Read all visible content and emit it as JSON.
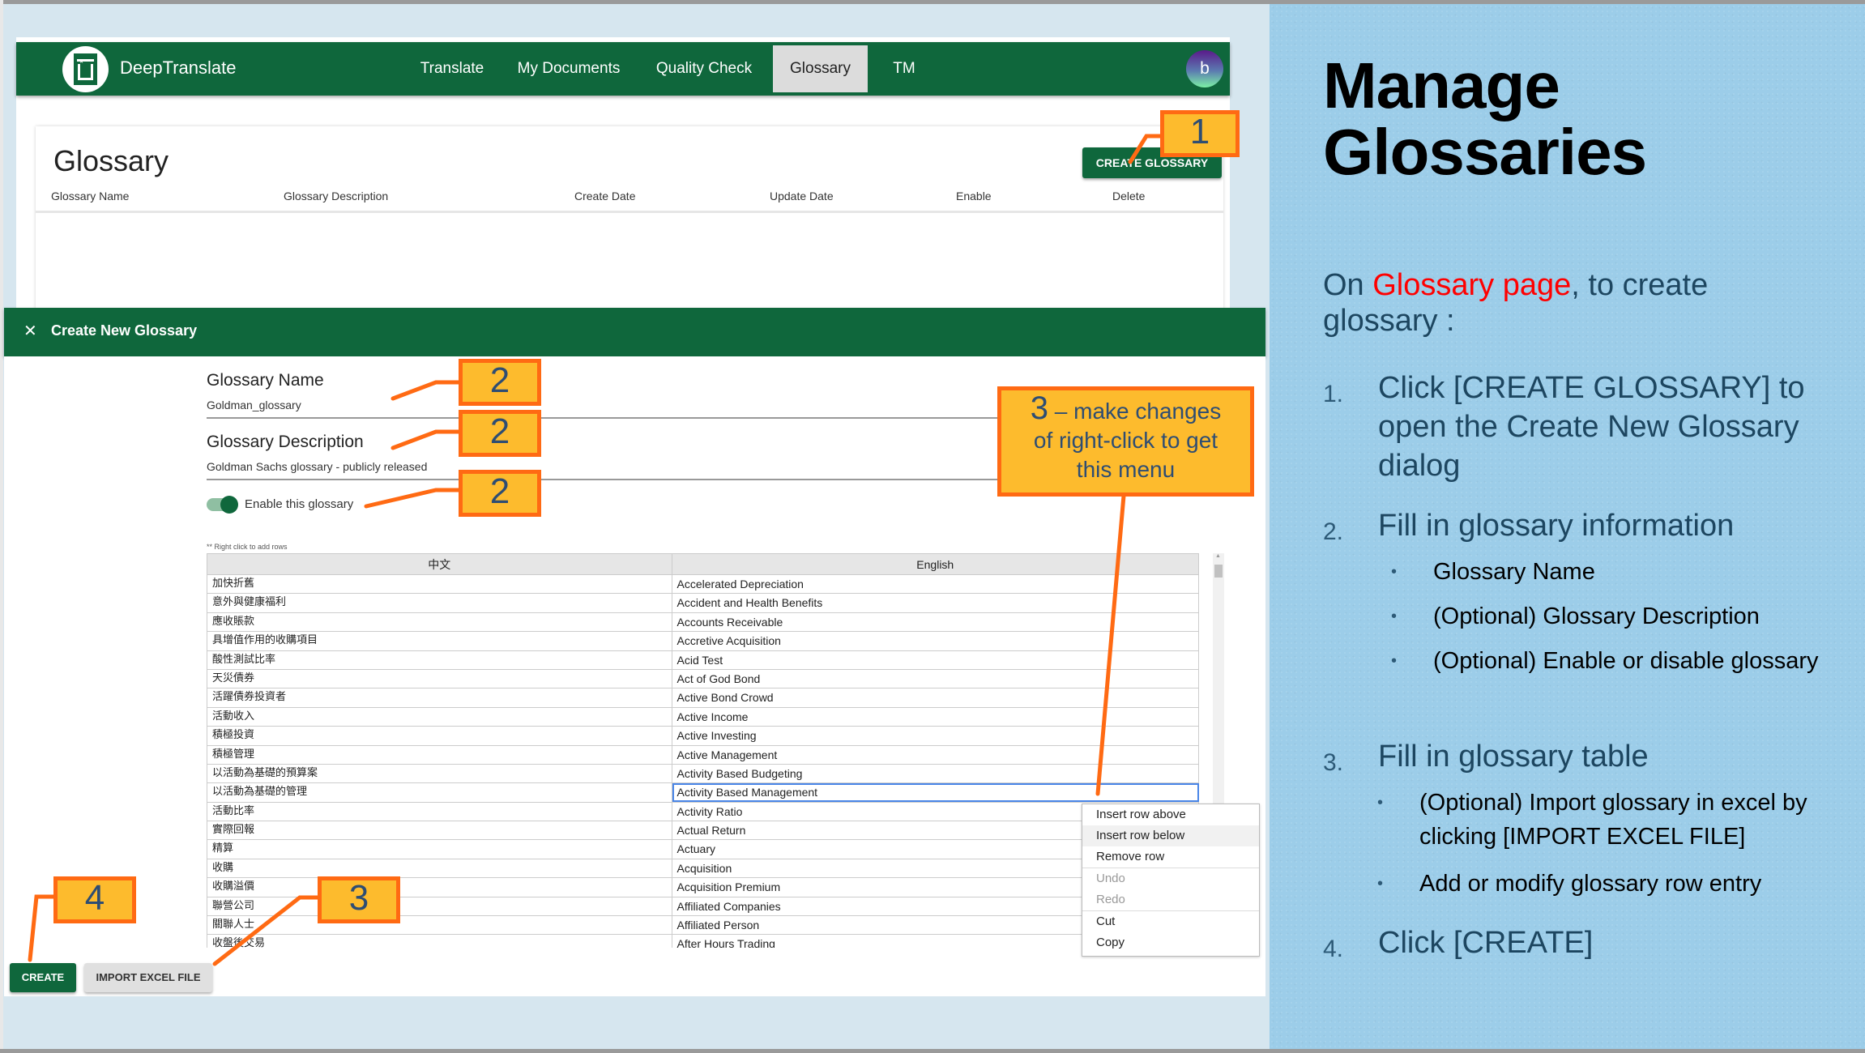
{
  "app": {
    "brand": "DeepTranslate",
    "logo_icon": "deeptranslate-logo-icon",
    "nav": [
      {
        "label": "Translate",
        "active": false
      },
      {
        "label": "My Documents",
        "active": false
      },
      {
        "label": "Quality Check",
        "active": false
      },
      {
        "label": "Glossary",
        "active": true
      },
      {
        "label": "TM",
        "active": false
      }
    ],
    "avatar_initial": "b",
    "accent_color": "#0f673c"
  },
  "glossary_page": {
    "title": "Glossary",
    "create_button": "CREATE GLOSSARY",
    "columns": [
      "Glossary Name",
      "Glossary Description",
      "Create Date",
      "Update Date",
      "Enable",
      "Delete"
    ]
  },
  "dialog": {
    "close_icon": "close-icon",
    "title": "Create New Glossary",
    "name_label": "Glossary Name",
    "name_value": "Goldman_glossary",
    "description_label": "Glossary Description",
    "description_value": "Goldman Sachs glossary - publicly released",
    "enable_label": "Enable this glossary",
    "enable_on": true,
    "hint": "** Right click to add rows",
    "table": {
      "headers": [
        "中文",
        "English"
      ],
      "rows": [
        [
          "加快折舊",
          "Accelerated Depreciation"
        ],
        [
          "意外與健康福利",
          "Accident and Health Benefits"
        ],
        [
          "應收賬款",
          "Accounts Receivable"
        ],
        [
          "具增值作用的收購項目",
          "Accretive Acquisition"
        ],
        [
          "酸性測試比率",
          "Acid Test"
        ],
        [
          "天災債券",
          "Act of God Bond"
        ],
        [
          "活躍債券投資者",
          "Active Bond Crowd"
        ],
        [
          "活動收入",
          "Active Income"
        ],
        [
          "積極投資",
          "Active Investing"
        ],
        [
          "積極管理",
          "Active Management"
        ],
        [
          "以活動為基礎的預算案",
          "Activity Based Budgeting"
        ],
        [
          "以活動為基礎的管理",
          "Activity Based Management"
        ],
        [
          "活動比率",
          "Activity Ratio"
        ],
        [
          "實際回報",
          "Actual Return"
        ],
        [
          "精算",
          "Actuary"
        ],
        [
          "收購",
          "Acquisition"
        ],
        [
          "收購溢價",
          "Acquisition Premium"
        ],
        [
          "聯營公司",
          "Affiliated Companies"
        ],
        [
          "關聯人士",
          "Affiliated Person"
        ],
        [
          "收盤後交易",
          "After Hours Trading"
        ]
      ],
      "selected_row": 11
    },
    "context_menu": [
      {
        "label": "Insert row above",
        "disabled": false,
        "hover": false
      },
      {
        "label": "Insert row below",
        "disabled": false,
        "hover": true
      },
      {
        "label": "Remove row",
        "disabled": false,
        "hover": false,
        "sep_after": true
      },
      {
        "label": "Undo",
        "disabled": true,
        "hover": false
      },
      {
        "label": "Redo",
        "disabled": true,
        "hover": false,
        "sep_after": true
      },
      {
        "label": "Cut",
        "disabled": false,
        "hover": false
      },
      {
        "label": "Copy",
        "disabled": false,
        "hover": false
      }
    ],
    "create_button": "CREATE",
    "import_button": "IMPORT EXCEL FILE"
  },
  "callouts": {
    "c1": "1",
    "c2": "2",
    "c3": "3",
    "c3_menu_num": "3",
    "c3_menu_text_1": " – make changes",
    "c3_menu_text_2": "of right-click to get",
    "c3_menu_text_3": "this menu",
    "c4": "4",
    "colors": {
      "fill": "#fdbb2d",
      "border": "#ff6a13",
      "text": "#2e4d73"
    }
  },
  "panel": {
    "title_line1": "Manage",
    "title_line2": "Glossaries",
    "intro_prefix": "On ",
    "intro_highlight": "Glossary page",
    "intro_suffix": ", to create glossary :",
    "steps": [
      {
        "num": "1.",
        "text": "Click [CREATE GLOSSARY] to open the Create New Glossary dialog",
        "bullets": []
      },
      {
        "num": "2.",
        "text": "Fill in glossary information",
        "bullets": [
          "Glossary Name",
          "(Optional) Glossary Description",
          "(Optional) Enable or disable glossary"
        ]
      },
      {
        "num": "3.",
        "text": "Fill in glossary table",
        "bullets": [
          "(Optional) Import glossary in excel by clicking [IMPORT EXCEL FILE]",
          "Add or modify glossary row entry"
        ]
      },
      {
        "num": "4.",
        "text": "Click [CREATE]",
        "bullets": []
      }
    ],
    "bullet_char": "•"
  }
}
